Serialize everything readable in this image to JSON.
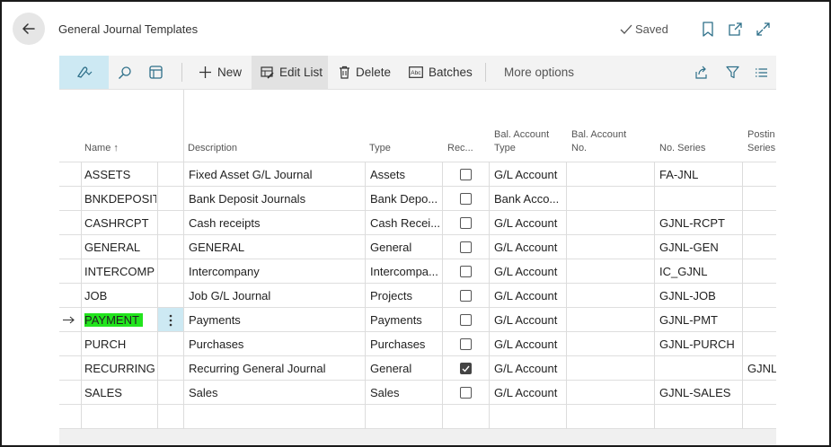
{
  "header": {
    "title": "General Journal Templates",
    "saved_label": "Saved",
    "icons": [
      "back-arrow-icon",
      "bookmark-icon",
      "open-new-window-icon",
      "expand-icon"
    ]
  },
  "toolbar": {
    "new_label": "New",
    "edit_list_label": "Edit List",
    "delete_label": "Delete",
    "batches_label": "Batches",
    "more_options_label": "More options"
  },
  "columns": {
    "name": "Name ↑",
    "description": "Description",
    "type": "Type",
    "recurring": "Rec...",
    "bal_account_type": [
      "Bal. Account",
      "Type"
    ],
    "bal_account_no": [
      "Bal. Account",
      "No."
    ],
    "no_series": "No. Series",
    "posting_no_series": [
      "Postin",
      "Series"
    ]
  },
  "rows": [
    {
      "name": "ASSETS",
      "description": "Fixed Asset G/L Journal",
      "type": "Assets",
      "recurring": false,
      "bal_type": "G/L Account",
      "bal_no": "",
      "no_series": "FA-JNL",
      "posting_series": ""
    },
    {
      "name": "BNKDEPOSIT",
      "description": "Bank Deposit Journals",
      "type": "Bank Depo...",
      "recurring": false,
      "bal_type": "Bank Acco...",
      "bal_no": "",
      "no_series": "",
      "posting_series": ""
    },
    {
      "name": "CASHRCPT",
      "description": "Cash receipts",
      "type": "Cash Recei...",
      "recurring": false,
      "bal_type": "G/L Account",
      "bal_no": "",
      "no_series": "GJNL-RCPT",
      "posting_series": ""
    },
    {
      "name": "GENERAL",
      "description": "GENERAL",
      "type": "General",
      "recurring": false,
      "bal_type": "G/L Account",
      "bal_no": "",
      "no_series": "GJNL-GEN",
      "posting_series": ""
    },
    {
      "name": "INTERCOMP",
      "description": "Intercompany",
      "type": "Intercompa...",
      "recurring": false,
      "bal_type": "G/L Account",
      "bal_no": "",
      "no_series": "IC_GJNL",
      "posting_series": ""
    },
    {
      "name": "JOB",
      "description": "Job G/L Journal",
      "type": "Projects",
      "recurring": false,
      "bal_type": "G/L Account",
      "bal_no": "",
      "no_series": "GJNL-JOB",
      "posting_series": ""
    },
    {
      "name": "PAYMENT",
      "description": "Payments",
      "type": "Payments",
      "recurring": false,
      "bal_type": "G/L Account",
      "bal_no": "",
      "no_series": "GJNL-PMT",
      "posting_series": "",
      "selected": true,
      "highlight_color": "#22e41d"
    },
    {
      "name": "PURCH",
      "description": "Purchases",
      "type": "Purchases",
      "recurring": false,
      "bal_type": "G/L Account",
      "bal_no": "",
      "no_series": "GJNL-PURCH",
      "posting_series": ""
    },
    {
      "name": "RECURRING",
      "description": "Recurring General Journal",
      "type": "General",
      "recurring": true,
      "bal_type": "G/L Account",
      "bal_no": "",
      "no_series": "",
      "posting_series": "GJNL"
    },
    {
      "name": "SALES",
      "description": "Sales",
      "type": "Sales",
      "recurring": false,
      "bal_type": "G/L Account",
      "bal_no": "",
      "no_series": "GJNL-SALES",
      "posting_series": ""
    }
  ],
  "colors": {
    "accent": "#2d6f89",
    "selected_row_marker_bg": "#cde9f3",
    "highlight": "#22e41d"
  }
}
